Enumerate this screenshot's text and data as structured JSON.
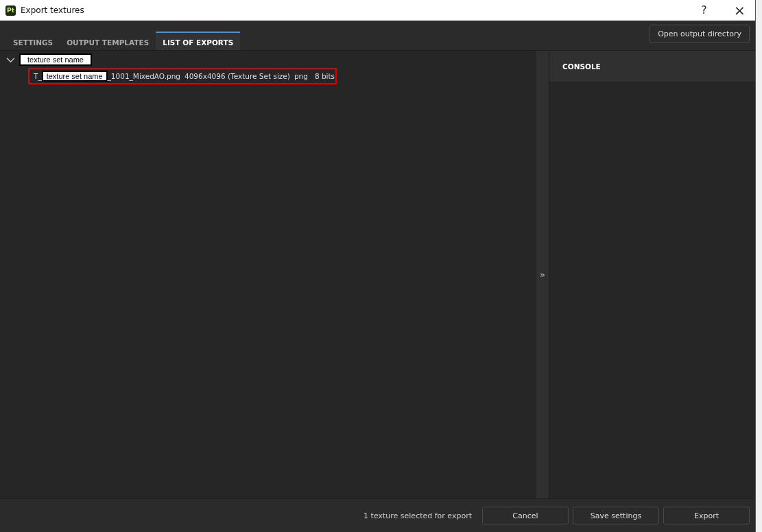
{
  "window": {
    "title": "Export textures",
    "app_badge": "Pt",
    "help": "?",
    "close": "×"
  },
  "tabs": [
    {
      "label": "SETTINGS",
      "selected": false
    },
    {
      "label": "OUTPUT TEMPLATES",
      "selected": false
    },
    {
      "label": "LIST OF EXPORTS",
      "selected": true
    }
  ],
  "open_dir_button": "Open output directory",
  "tree": [
    {
      "label": "texture set name",
      "expanded": true,
      "children": [
        {
          "prefix": "T_",
          "name_label": "texture set name",
          "file": "_1001_MixedAO.png",
          "size": "4096x4096 (Texture Set size)",
          "format": "png",
          "bits": "8 bits",
          "highlighted": true
        }
      ]
    }
  ],
  "splitter": "»",
  "console": {
    "title": "CONSOLE"
  },
  "footer": {
    "status": "1 texture selected for export",
    "buttons": [
      "Cancel",
      "Save settings",
      "Export"
    ]
  }
}
